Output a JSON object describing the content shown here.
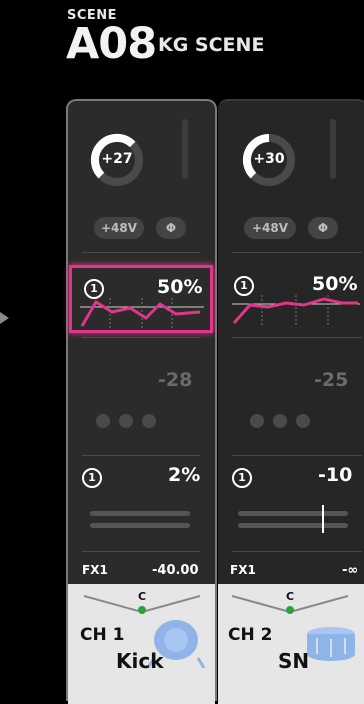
{
  "scene": {
    "caption": "SCENE",
    "number": "A08",
    "name": "KG SCENE"
  },
  "channels": [
    {
      "gain": "+27",
      "gain_level": 0.78,
      "phantom": "+48V",
      "phase": "Φ",
      "hpf_num": "1",
      "eq_amount": "50%",
      "gate_value": "-28",
      "send_num": "1",
      "send_value": "2%",
      "fx_label": "FX1",
      "fx_value": "-40.00",
      "pan": "C",
      "ch_label": "CH 1",
      "ch_name": "Kick",
      "icon": "kick-drum-icon",
      "selected": true
    },
    {
      "gain": "+30",
      "gain_level": 0.62,
      "phantom": "+48V",
      "phase": "Φ",
      "hpf_num": "1",
      "eq_amount": "50%",
      "gate_value": "-25",
      "send_num": "1",
      "send_value": "-10",
      "fx_label": "FX1",
      "fx_value": "-∞",
      "pan": "C",
      "ch_label": "CH 2",
      "ch_name": "SN",
      "icon": "snare-drum-icon",
      "selected": false
    }
  ],
  "colors": {
    "accent": "#e0358a",
    "pan_dot": "#2aa040",
    "drum_icon": "#8fb4e8"
  }
}
